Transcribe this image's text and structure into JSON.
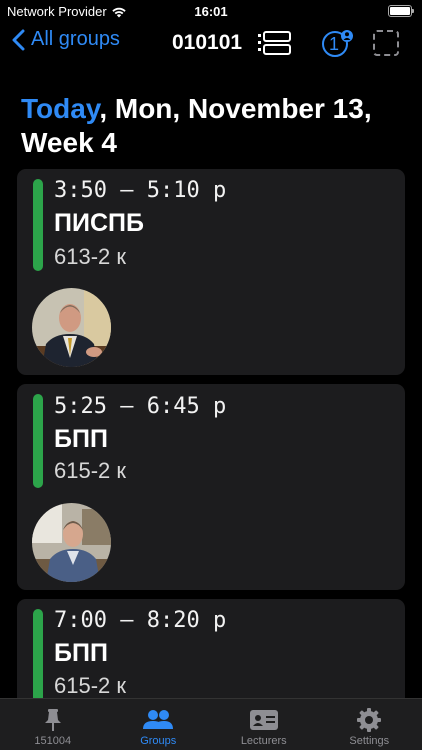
{
  "status_bar": {
    "carrier": "Network Provider",
    "time": "16:01"
  },
  "nav": {
    "back_label": "All groups",
    "title": "010101",
    "badge_count": "1"
  },
  "date_header": {
    "today": "Today",
    "rest": ", Mon, November 13, Week 4"
  },
  "lessons": [
    {
      "time": "3:50 — 5:10 p",
      "subject": "ПИСПБ",
      "room": "613-2 к"
    },
    {
      "time": "5:25 — 6:45 p",
      "subject": "БПП",
      "room": "615-2 к"
    },
    {
      "time": "7:00 — 8:20 p",
      "subject": "БПП",
      "room": "615-2 к"
    }
  ],
  "tabs": [
    {
      "label": "151004",
      "icon": "pin-icon"
    },
    {
      "label": "Groups",
      "icon": "people-icon",
      "active": true
    },
    {
      "label": "Lecturers",
      "icon": "id-card-icon"
    },
    {
      "label": "Settings",
      "icon": "gear-icon"
    }
  ],
  "colors": {
    "accent": "#2f8af5",
    "lesson_bar": "#2ca44a",
    "card_bg": "#1c1c1e"
  }
}
